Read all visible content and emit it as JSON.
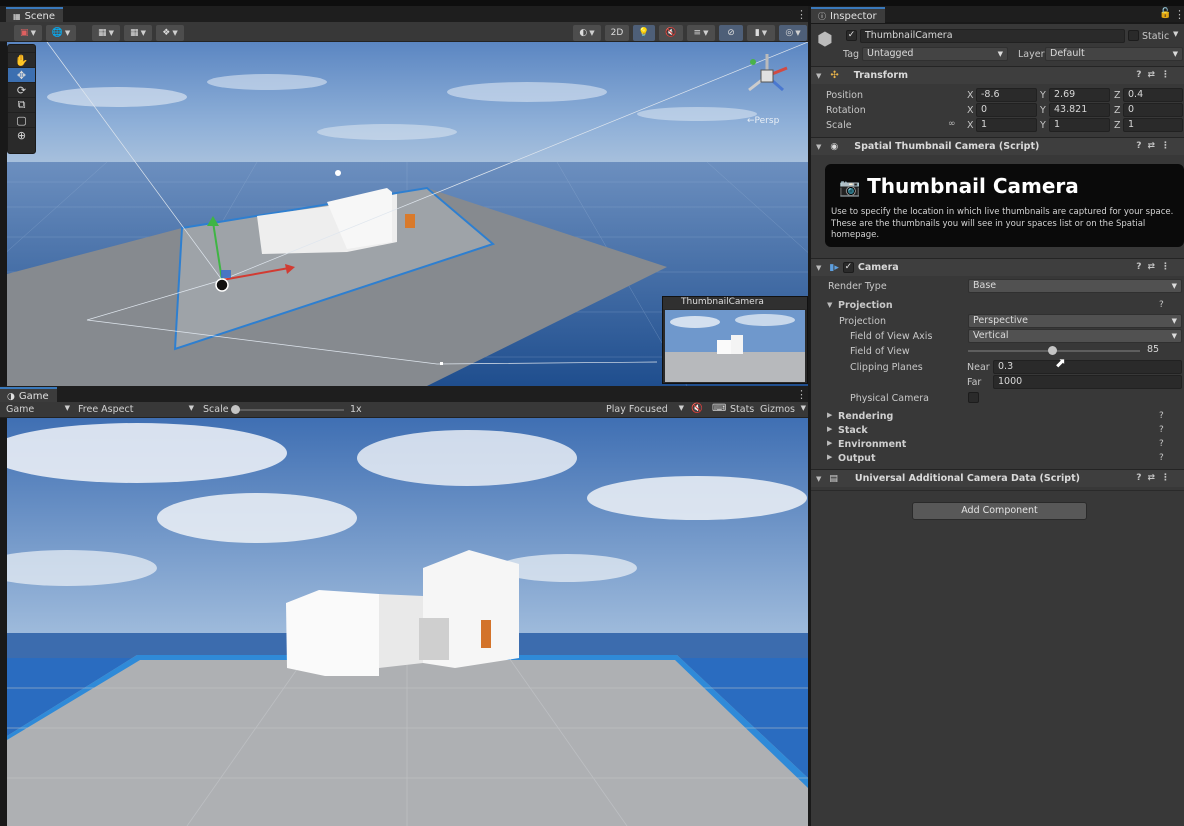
{
  "scene": {
    "tab_label": "Scene",
    "toolbar_2d_label": "2D",
    "persp_label": "←Persp",
    "preview_title": "ThumbnailCamera",
    "tools": [
      "hand-tool",
      "move-tool",
      "rotate-tool",
      "scale-tool",
      "rect-tool",
      "transform-tool"
    ]
  },
  "game": {
    "tab_label": "Game",
    "display_label": "Game",
    "aspect_label": "Free Aspect",
    "scale_label": "Scale",
    "scale_value": "1x",
    "play_mode_label": "Play Focused",
    "stats_label": "Stats",
    "gizmos_label": "Gizmos"
  },
  "inspector": {
    "tab_label": "Inspector",
    "object_name": "ThumbnailCamera",
    "static_label": "Static",
    "tag_label": "Tag",
    "tag_value": "Untagged",
    "layer_label": "Layer",
    "layer_value": "Default",
    "transform": {
      "title": "Transform",
      "position_label": "Position",
      "rotation_label": "Rotation",
      "scale_label": "Scale",
      "position": {
        "x": "-8.6",
        "y": "2.69",
        "z": "0.4"
      },
      "rotation": {
        "x": "0",
        "y": "43.821",
        "z": "0"
      },
      "scale": {
        "x": "1",
        "y": "1",
        "z": "1"
      }
    },
    "spatial_script": {
      "title": "Spatial Thumbnail Camera (Script)",
      "card_title": "Thumbnail Camera",
      "card_text": "Use to specify the location in which live thumbnails are captured for your space. These are the thumbnails you will see in your spaces list or on the Spatial homepage."
    },
    "camera": {
      "title": "Camera",
      "render_type_label": "Render Type",
      "render_type_value": "Base",
      "projection_section": "Projection",
      "projection_label": "Projection",
      "projection_value": "Perspective",
      "fov_axis_label": "Field of View Axis",
      "fov_axis_value": "Vertical",
      "fov_label": "Field of View",
      "fov_value": "85",
      "fov_slider_fraction": 0.49,
      "clipping_label": "Clipping Planes",
      "near_label": "Near",
      "near_value": "0.3",
      "far_label": "Far",
      "far_value": "1000",
      "physical_camera_label": "Physical Camera",
      "sections": [
        "Rendering",
        "Stack",
        "Environment",
        "Output"
      ]
    },
    "additional_data": {
      "title": "Universal Additional Camera Data (Script)"
    },
    "add_component_label": "Add Component"
  }
}
